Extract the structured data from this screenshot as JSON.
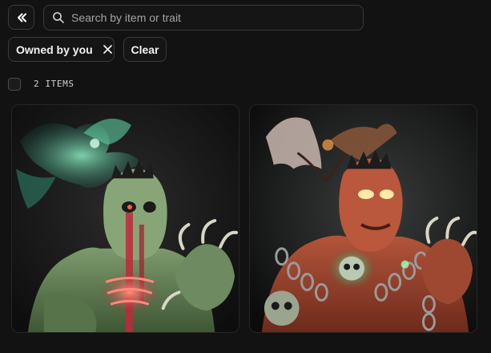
{
  "toolbar": {
    "collapse_icon": "chevrons-left-icon",
    "search": {
      "icon": "search-icon",
      "placeholder": "Search by item or trait",
      "value": ""
    }
  },
  "filters": {
    "active": [
      {
        "label": "Owned by you",
        "remove_icon": "close-icon"
      }
    ],
    "clear_label": "Clear"
  },
  "results": {
    "count_label": "2 ITEMS"
  },
  "items": [
    {
      "artwork": "green-undead-warrior-with-spectral-bird"
    },
    {
      "artwork": "red-chained-demon-with-bat-wings"
    }
  ],
  "colors": {
    "background": "#121212",
    "border": "#3a3a3a",
    "text": "#f2f2f2",
    "muted": "#a3a3a3"
  }
}
